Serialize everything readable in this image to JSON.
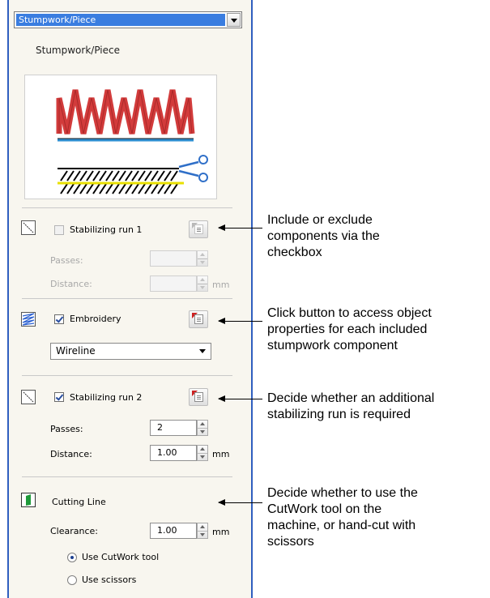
{
  "top_dropdown": {
    "value": "Stumpwork/Piece"
  },
  "header_label": "Stumpwork/Piece",
  "stabilizing_run_1": {
    "label": "Stabilizing run 1",
    "checked": false,
    "passes_label": "Passes:",
    "passes_value": "",
    "distance_label": "Distance:",
    "distance_value": "",
    "unit": "mm"
  },
  "embroidery": {
    "label": "Embroidery",
    "checked": true,
    "style_value": "Wireline"
  },
  "stabilizing_run_2": {
    "label": "Stabilizing run 2",
    "checked": true,
    "passes_label": "Passes:",
    "passes_value": "2",
    "distance_label": "Distance:",
    "distance_value": "1.00",
    "unit": "mm"
  },
  "cutting_line": {
    "label": "Cutting Line",
    "clearance_label": "Clearance:",
    "clearance_value": "1.00",
    "unit": "mm",
    "option_cutwork": "Use CutWork tool",
    "option_scissors": "Use scissors",
    "selected": "Use CutWork tool"
  },
  "annotations": [
    "Include or exclude\ncomponents via the\ncheckbox",
    "Click button to access object\nproperties for each included\nstumpwork component",
    "Decide whether an additional\nstabilizing run is required",
    "Decide whether to use the\nCutWork tool on the\nmachine, or hand-cut with\nscissors"
  ],
  "colors": {
    "panel_border": "#2f5fbf",
    "selection": "#3a7de0",
    "stitch_red": "#d23b3b",
    "run_blue": "#2f8fd0",
    "yellow_line": "#e8e000"
  }
}
